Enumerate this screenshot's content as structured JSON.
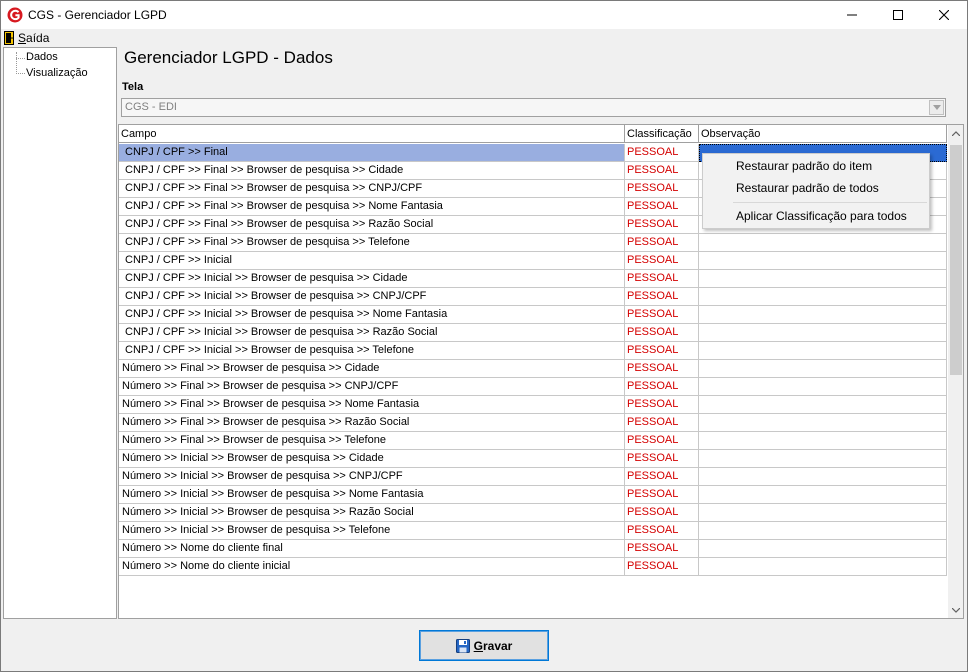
{
  "window": {
    "title": "CGS - Gerenciador LGPD",
    "icons": {
      "logo": "cgs-logo-icon",
      "minimize": "minimize-icon",
      "maximize": "maximize-icon",
      "close": "close-icon"
    }
  },
  "menu": {
    "items": [
      {
        "label": "Saída",
        "icon": "exit-door-icon"
      }
    ]
  },
  "tree": {
    "items": [
      {
        "label": "Dados"
      },
      {
        "label": "Visualização"
      }
    ]
  },
  "page": {
    "title": "Gerenciador LGPD - Dados"
  },
  "tela": {
    "label": "Tela",
    "value": "CGS - EDI"
  },
  "grid": {
    "columns": [
      "Campo",
      "Classificação",
      "Observação"
    ],
    "selected_row": 0,
    "rows": [
      {
        "campo": "CNPJ / CPF >> Final",
        "classificacao": "PESSOAL",
        "observacao": ""
      },
      {
        "campo": "CNPJ / CPF >> Final >> Browser de pesquisa >> Cidade",
        "classificacao": "PESSOAL",
        "observacao": ""
      },
      {
        "campo": "CNPJ / CPF >> Final >> Browser de pesquisa >> CNPJ/CPF",
        "classificacao": "PESSOAL",
        "observacao": ""
      },
      {
        "campo": "CNPJ / CPF >> Final >> Browser de pesquisa >> Nome Fantasia",
        "classificacao": "PESSOAL",
        "observacao": ""
      },
      {
        "campo": "CNPJ / CPF >> Final >> Browser de pesquisa >> Razão Social",
        "classificacao": "PESSOAL",
        "observacao": ""
      },
      {
        "campo": "CNPJ / CPF >> Final >> Browser de pesquisa >> Telefone",
        "classificacao": "PESSOAL",
        "observacao": ""
      },
      {
        "campo": "CNPJ / CPF >> Inicial",
        "classificacao": "PESSOAL",
        "observacao": ""
      },
      {
        "campo": "CNPJ / CPF >> Inicial >> Browser de pesquisa >> Cidade",
        "classificacao": "PESSOAL",
        "observacao": ""
      },
      {
        "campo": "CNPJ / CPF >> Inicial >> Browser de pesquisa >> CNPJ/CPF",
        "classificacao": "PESSOAL",
        "observacao": ""
      },
      {
        "campo": "CNPJ / CPF >> Inicial >> Browser de pesquisa >> Nome Fantasia",
        "classificacao": "PESSOAL",
        "observacao": ""
      },
      {
        "campo": "CNPJ / CPF >> Inicial >> Browser de pesquisa >> Razão Social",
        "classificacao": "PESSOAL",
        "observacao": ""
      },
      {
        "campo": "CNPJ / CPF >> Inicial >> Browser de pesquisa >> Telefone",
        "classificacao": "PESSOAL",
        "observacao": ""
      },
      {
        "campo": "Número >> Final >> Browser de pesquisa >> Cidade",
        "classificacao": "PESSOAL",
        "observacao": ""
      },
      {
        "campo": "Número >> Final >> Browser de pesquisa >> CNPJ/CPF",
        "classificacao": "PESSOAL",
        "observacao": ""
      },
      {
        "campo": "Número >> Final >> Browser de pesquisa >> Nome Fantasia",
        "classificacao": "PESSOAL",
        "observacao": ""
      },
      {
        "campo": "Número >> Final >> Browser de pesquisa >> Razão Social",
        "classificacao": "PESSOAL",
        "observacao": ""
      },
      {
        "campo": "Número >> Final >> Browser de pesquisa >> Telefone",
        "classificacao": "PESSOAL",
        "observacao": ""
      },
      {
        "campo": "Número >> Inicial >> Browser de pesquisa >> Cidade",
        "classificacao": "PESSOAL",
        "observacao": ""
      },
      {
        "campo": "Número >> Inicial >> Browser de pesquisa >> CNPJ/CPF",
        "classificacao": "PESSOAL",
        "observacao": ""
      },
      {
        "campo": "Número >> Inicial >> Browser de pesquisa >> Nome Fantasia",
        "classificacao": "PESSOAL",
        "observacao": ""
      },
      {
        "campo": "Número >> Inicial >> Browser de pesquisa >> Razão Social",
        "classificacao": "PESSOAL",
        "observacao": ""
      },
      {
        "campo": "Número >> Inicial >> Browser de pesquisa >> Telefone",
        "classificacao": "PESSOAL",
        "observacao": ""
      },
      {
        "campo": "Número >> Nome do cliente final",
        "classificacao": "PESSOAL",
        "observacao": ""
      },
      {
        "campo": "Número >> Nome do cliente inicial",
        "classificacao": "PESSOAL",
        "observacao": ""
      }
    ]
  },
  "context_menu": {
    "items": [
      "Restaurar padrão do item",
      "Restaurar padrão de todos",
      "Aplicar Classificação para todos"
    ]
  },
  "save_button": {
    "label": "Gravar",
    "icon": "floppy-disk-icon"
  },
  "colors": {
    "selection": "#99aee0",
    "classification_text": "#d40000",
    "focus_cell": "#2b6ad3",
    "button_border": "#0078d7"
  }
}
